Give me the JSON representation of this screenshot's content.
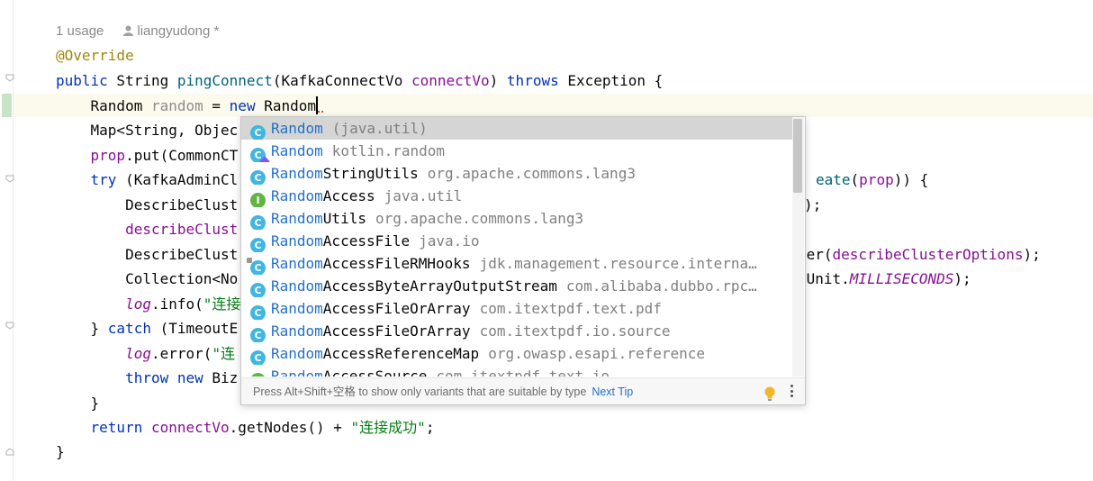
{
  "hint": {
    "usages": "1 usage",
    "author": "liangyudong *"
  },
  "code": {
    "l1": {
      "ann": "@Override"
    },
    "l2": {
      "kw1": "public",
      "t1": " String ",
      "fn": "pingConnect",
      "t2": "(KafkaConnectVo ",
      "param": "connectVo",
      "t3": ") ",
      "kw2": "throws",
      "t4": " Exception {"
    },
    "l3": {
      "t1": "    Random ",
      "var": "random",
      "t2": " = ",
      "kw": "new",
      "t3": " Random"
    },
    "l4": {
      "t1": "    Map<String, Objec"
    },
    "l5": {
      "var": "    prop",
      "t1": ".put(CommonCT"
    },
    "l6": {
      "kw": "    try",
      "t1": " (KafkaAdminCl",
      "fn": "eate",
      "t2": "(",
      "var": "prop",
      "t3": ")) {"
    },
    "l7": {
      "t1": "        DescribeClust",
      "t2": ");"
    },
    "l8": {
      "var": "        describeClust"
    },
    "l9": {
      "t1": "        DescribeClust",
      "t2": "ter(",
      "var": "describeClusterOptions",
      "t3": ");"
    },
    "l10": {
      "t1": "        Collection<No",
      "t2": "eUnit.",
      "static": "MILLISECONDS",
      "t3": ");"
    },
    "l11": {
      "logf": "        log",
      "t1": ".info(",
      "str": "\"连接"
    },
    "l12": {
      "t1": "    } ",
      "kw": "catch",
      "t2": " (TimeoutE"
    },
    "l13": {
      "logf": "        log",
      "t1": ".error(",
      "str": "\"连"
    },
    "l14": {
      "kw1": "        throw",
      "t1": " ",
      "kw2": "new",
      "t2": " Biz"
    },
    "l15": {
      "t1": "    }"
    },
    "l16": {
      "kw": "    return",
      "t1": " ",
      "var": "connectVo",
      "t2": ".getNodes() + ",
      "str": "\"连接成功\"",
      "t3": ";"
    },
    "l17": {
      "t1": "}"
    }
  },
  "completion": {
    "items": [
      {
        "icon": "C",
        "match": "Random",
        "rest": "",
        "pkg": "(java.util)"
      },
      {
        "icon": "C",
        "match": "Random",
        "rest": "",
        "pkg": "kotlin.random"
      },
      {
        "icon": "C",
        "match": "Random",
        "rest": "StringUtils",
        "pkg": "org.apache.commons.lang3"
      },
      {
        "icon": "I",
        "match": "Random",
        "rest": "Access",
        "pkg": "java.util"
      },
      {
        "icon": "C",
        "match": "Random",
        "rest": "Utils",
        "pkg": "org.apache.commons.lang3"
      },
      {
        "icon": "C",
        "match": "Random",
        "rest": "AccessFile",
        "pkg": "java.io"
      },
      {
        "icon": "C",
        "match": "Random",
        "rest": "AccessFileRMHooks",
        "pkg": "jdk.management.resource.interna…"
      },
      {
        "icon": "C",
        "match": "Random",
        "rest": "AccessByteArrayOutputStream",
        "pkg": "com.alibaba.dubbo.rpc…"
      },
      {
        "icon": "C",
        "match": "Random",
        "rest": "AccessFileOrArray",
        "pkg": "com.itextpdf.text.pdf"
      },
      {
        "icon": "C",
        "match": "Random",
        "rest": "AccessFileOrArray",
        "pkg": "com.itextpdf.io.source"
      },
      {
        "icon": "C",
        "match": "Random",
        "rest": "AccessReferenceMap",
        "pkg": "org.owasp.esapi.reference"
      },
      {
        "icon": "I",
        "match": "Random",
        "rest": "AccessSource",
        "pkg": "com.itextpdf.text.io"
      }
    ],
    "footer_tip": "Press Alt+Shift+空格 to show only variants that are suitable by type",
    "next_tip": "Next Tip"
  }
}
